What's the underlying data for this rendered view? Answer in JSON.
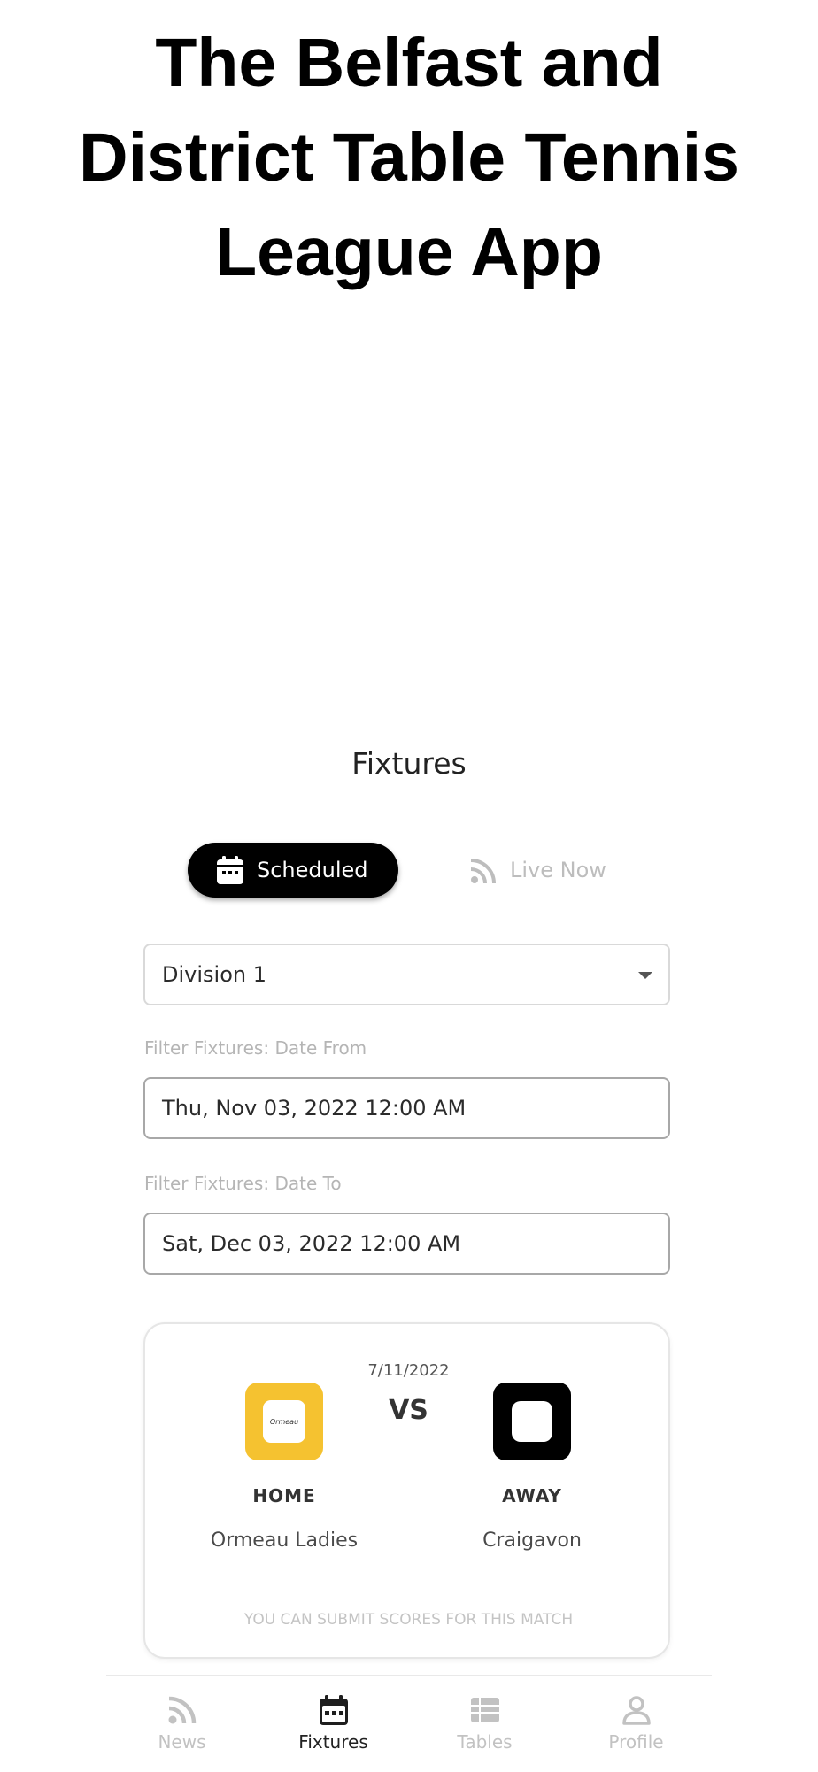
{
  "headline": {
    "line1": "The Belfast and",
    "line2": "District Table Tennis",
    "line3": "League App"
  },
  "screen": {
    "title": "Fixtures"
  },
  "segmented_control": {
    "scheduled_label": "Scheduled",
    "scheduled_icon": "calendar-icon",
    "live_label": "Live Now",
    "live_icon": "rss-feed-icon",
    "active": "Scheduled"
  },
  "filters": {
    "division": "Division 1",
    "date_from_label": "Filter Fixtures: Date From",
    "date_from_value": "Thu, Nov 03, 2022 12:00 AM",
    "date_to_label": "Filter Fixtures: Date To",
    "date_to_value": "Sat, Dec 03, 2022 12:00 AM"
  },
  "match": {
    "date": "7/11/2022",
    "vs": "VS",
    "home_label": "HOME",
    "home_team": "Ormeau Ladies",
    "home_logo_text": "Ormeau",
    "away_label": "AWAY",
    "away_team": "Craigavon",
    "note": "YOU CAN SUBMIT SCORES FOR THIS MATCH"
  },
  "tabbar": {
    "items": [
      {
        "label": "News",
        "icon": "rss-feed-icon"
      },
      {
        "label": "Fixtures",
        "icon": "calendar-icon"
      },
      {
        "label": "Tables",
        "icon": "table-list-icon"
      },
      {
        "label": "Profile",
        "icon": "user-icon"
      }
    ],
    "active": "Fixtures"
  },
  "colors": {
    "accent": "#000000",
    "home_logo": "#f5c230",
    "away_logo": "#000000",
    "inactive": "#c2c2c2"
  }
}
